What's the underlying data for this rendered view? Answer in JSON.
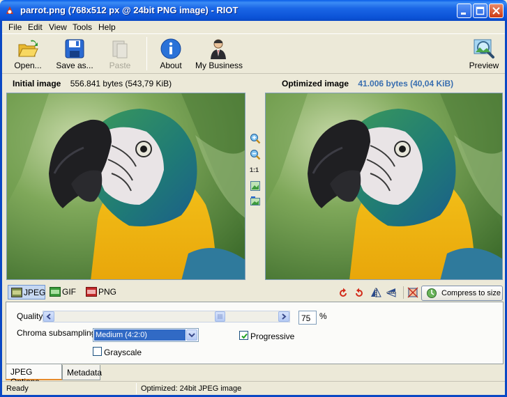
{
  "window": {
    "title": "parrot.png (768x512 px @ 24bit PNG image) - RIOT"
  },
  "menu": [
    "File",
    "Edit",
    "View",
    "Tools",
    "Help"
  ],
  "toolbar": {
    "open": "Open...",
    "save_as": "Save as...",
    "paste": "Paste",
    "about": "About",
    "my_business": "My Business",
    "preview": "Preview"
  },
  "info": {
    "initial_label": "Initial image",
    "initial_size": "556.841 bytes (543,79 KiB)",
    "optimized_label": "Optimized image",
    "optimized_size": "41.006 bytes (40,04 KiB)"
  },
  "image_tools": {
    "actual_size_label": "1:1"
  },
  "formats": {
    "jpeg": "JPEG",
    "gif": "GIF",
    "png": "PNG",
    "compress_label": "Compress to size"
  },
  "options": {
    "quality_label": "Quality",
    "quality_value": "75",
    "quality_unit": "%",
    "chroma_label": "Chroma subsampling",
    "chroma_value": "Medium (4:2:0)",
    "progressive_label": "Progressive",
    "progressive_checked": true,
    "grayscale_label": "Grayscale",
    "grayscale_checked": false
  },
  "bottom_tabs": {
    "jpeg_options": "JPEG Options",
    "metadata": "Metadata"
  },
  "status": {
    "left": "Ready",
    "right": "Optimized: 24bit JPEG image"
  },
  "colors": {
    "accent": "#0a48c4",
    "optimized_size": "#3a6fb0",
    "selection": "#316ac5"
  }
}
